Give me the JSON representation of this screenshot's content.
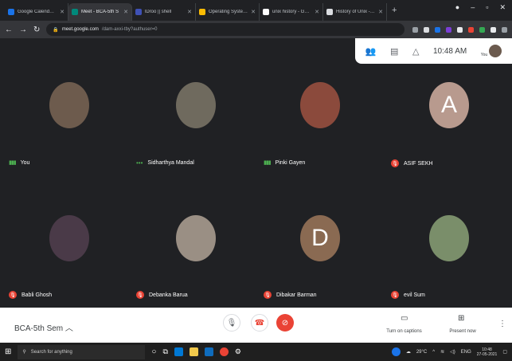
{
  "browser": {
    "tabs": [
      {
        "title": "Google Calendar - Mo",
        "color": "#1a73e8",
        "active": false
      },
      {
        "title": "Meet - BCA-5th S",
        "color": "#00897b",
        "active": true
      },
      {
        "title": "lDroo || shell",
        "color": "#3f51b5",
        "active": false
      },
      {
        "title": "Operating System - G",
        "color": "#fbbc04",
        "active": false
      },
      {
        "title": "unix history - Google",
        "color": "#ffffff",
        "active": false
      },
      {
        "title": "History of Unix - Wiki",
        "color": "#dadce0",
        "active": false
      }
    ],
    "url_host": "meet.google.com",
    "url_path": "/dam-axxi-tby?authuser=0"
  },
  "meet": {
    "time": "10:48 AM",
    "you_label": "You",
    "meeting_name": "BCA-5th Sem",
    "captions_label": "Turn on captions",
    "present_label": "Present now"
  },
  "participants": [
    {
      "name": "You",
      "status": "speaking",
      "letter": "",
      "bg": "#6d5b4d"
    },
    {
      "name": "Sidharthya Mandal",
      "status": "dots",
      "letter": "",
      "bg": "#6f6a5e"
    },
    {
      "name": "Pinki Gayen",
      "status": "speaking",
      "letter": "",
      "bg": "#8b4a3c"
    },
    {
      "name": "ASIF SEKH",
      "status": "muted",
      "letter": "A",
      "bg": "#b89a8e"
    },
    {
      "name": "Babli Ghosh",
      "status": "muted",
      "letter": "",
      "bg": "#4a3a48"
    },
    {
      "name": "Debanka Barua",
      "status": "muted",
      "letter": "",
      "bg": "#9a8f84"
    },
    {
      "name": "Dibakar Barman",
      "status": "muted",
      "letter": "D",
      "bg": "#8a6a52"
    },
    {
      "name": "evil Sum",
      "status": "muted",
      "letter": "",
      "bg": "#7a8e6a"
    }
  ],
  "taskbar": {
    "search_placeholder": "Search for anything",
    "weather": "29°C",
    "lang": "ENG",
    "time": "10:48",
    "date": "27-05-2021"
  }
}
